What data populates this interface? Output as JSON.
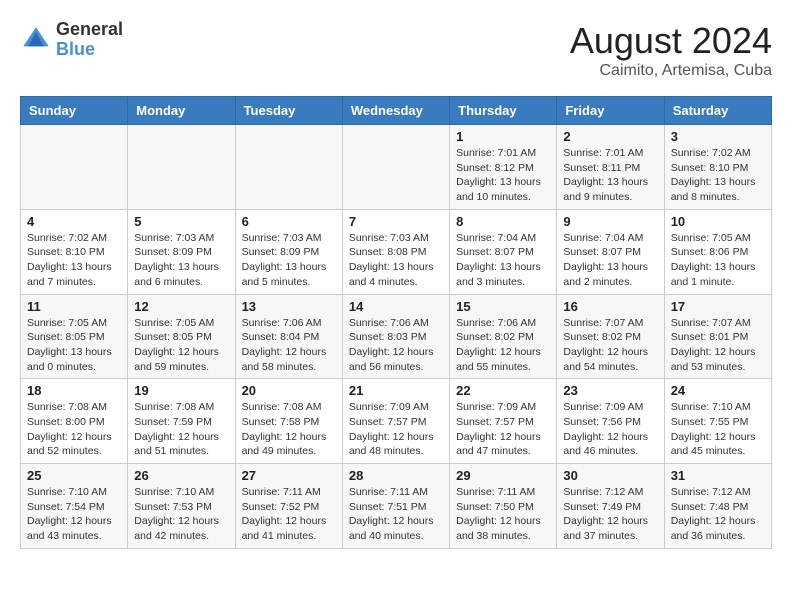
{
  "header": {
    "logo_general": "General",
    "logo_blue": "Blue",
    "month_year": "August 2024",
    "location": "Caimito, Artemisa, Cuba"
  },
  "weekdays": [
    "Sunday",
    "Monday",
    "Tuesday",
    "Wednesday",
    "Thursday",
    "Friday",
    "Saturday"
  ],
  "weeks": [
    [
      {
        "day": "",
        "info": ""
      },
      {
        "day": "",
        "info": ""
      },
      {
        "day": "",
        "info": ""
      },
      {
        "day": "",
        "info": ""
      },
      {
        "day": "1",
        "info": "Sunrise: 7:01 AM\nSunset: 8:12 PM\nDaylight: 13 hours and 10 minutes."
      },
      {
        "day": "2",
        "info": "Sunrise: 7:01 AM\nSunset: 8:11 PM\nDaylight: 13 hours and 9 minutes."
      },
      {
        "day": "3",
        "info": "Sunrise: 7:02 AM\nSunset: 8:10 PM\nDaylight: 13 hours and 8 minutes."
      }
    ],
    [
      {
        "day": "4",
        "info": "Sunrise: 7:02 AM\nSunset: 8:10 PM\nDaylight: 13 hours and 7 minutes."
      },
      {
        "day": "5",
        "info": "Sunrise: 7:03 AM\nSunset: 8:09 PM\nDaylight: 13 hours and 6 minutes."
      },
      {
        "day": "6",
        "info": "Sunrise: 7:03 AM\nSunset: 8:09 PM\nDaylight: 13 hours and 5 minutes."
      },
      {
        "day": "7",
        "info": "Sunrise: 7:03 AM\nSunset: 8:08 PM\nDaylight: 13 hours and 4 minutes."
      },
      {
        "day": "8",
        "info": "Sunrise: 7:04 AM\nSunset: 8:07 PM\nDaylight: 13 hours and 3 minutes."
      },
      {
        "day": "9",
        "info": "Sunrise: 7:04 AM\nSunset: 8:07 PM\nDaylight: 13 hours and 2 minutes."
      },
      {
        "day": "10",
        "info": "Sunrise: 7:05 AM\nSunset: 8:06 PM\nDaylight: 13 hours and 1 minute."
      }
    ],
    [
      {
        "day": "11",
        "info": "Sunrise: 7:05 AM\nSunset: 8:05 PM\nDaylight: 13 hours and 0 minutes."
      },
      {
        "day": "12",
        "info": "Sunrise: 7:05 AM\nSunset: 8:05 PM\nDaylight: 12 hours and 59 minutes."
      },
      {
        "day": "13",
        "info": "Sunrise: 7:06 AM\nSunset: 8:04 PM\nDaylight: 12 hours and 58 minutes."
      },
      {
        "day": "14",
        "info": "Sunrise: 7:06 AM\nSunset: 8:03 PM\nDaylight: 12 hours and 56 minutes."
      },
      {
        "day": "15",
        "info": "Sunrise: 7:06 AM\nSunset: 8:02 PM\nDaylight: 12 hours and 55 minutes."
      },
      {
        "day": "16",
        "info": "Sunrise: 7:07 AM\nSunset: 8:02 PM\nDaylight: 12 hours and 54 minutes."
      },
      {
        "day": "17",
        "info": "Sunrise: 7:07 AM\nSunset: 8:01 PM\nDaylight: 12 hours and 53 minutes."
      }
    ],
    [
      {
        "day": "18",
        "info": "Sunrise: 7:08 AM\nSunset: 8:00 PM\nDaylight: 12 hours and 52 minutes."
      },
      {
        "day": "19",
        "info": "Sunrise: 7:08 AM\nSunset: 7:59 PM\nDaylight: 12 hours and 51 minutes."
      },
      {
        "day": "20",
        "info": "Sunrise: 7:08 AM\nSunset: 7:58 PM\nDaylight: 12 hours and 49 minutes."
      },
      {
        "day": "21",
        "info": "Sunrise: 7:09 AM\nSunset: 7:57 PM\nDaylight: 12 hours and 48 minutes."
      },
      {
        "day": "22",
        "info": "Sunrise: 7:09 AM\nSunset: 7:57 PM\nDaylight: 12 hours and 47 minutes."
      },
      {
        "day": "23",
        "info": "Sunrise: 7:09 AM\nSunset: 7:56 PM\nDaylight: 12 hours and 46 minutes."
      },
      {
        "day": "24",
        "info": "Sunrise: 7:10 AM\nSunset: 7:55 PM\nDaylight: 12 hours and 45 minutes."
      }
    ],
    [
      {
        "day": "25",
        "info": "Sunrise: 7:10 AM\nSunset: 7:54 PM\nDaylight: 12 hours and 43 minutes."
      },
      {
        "day": "26",
        "info": "Sunrise: 7:10 AM\nSunset: 7:53 PM\nDaylight: 12 hours and 42 minutes."
      },
      {
        "day": "27",
        "info": "Sunrise: 7:11 AM\nSunset: 7:52 PM\nDaylight: 12 hours and 41 minutes."
      },
      {
        "day": "28",
        "info": "Sunrise: 7:11 AM\nSunset: 7:51 PM\nDaylight: 12 hours and 40 minutes."
      },
      {
        "day": "29",
        "info": "Sunrise: 7:11 AM\nSunset: 7:50 PM\nDaylight: 12 hours and 38 minutes."
      },
      {
        "day": "30",
        "info": "Sunrise: 7:12 AM\nSunset: 7:49 PM\nDaylight: 12 hours and 37 minutes."
      },
      {
        "day": "31",
        "info": "Sunrise: 7:12 AM\nSunset: 7:48 PM\nDaylight: 12 hours and 36 minutes."
      }
    ]
  ]
}
